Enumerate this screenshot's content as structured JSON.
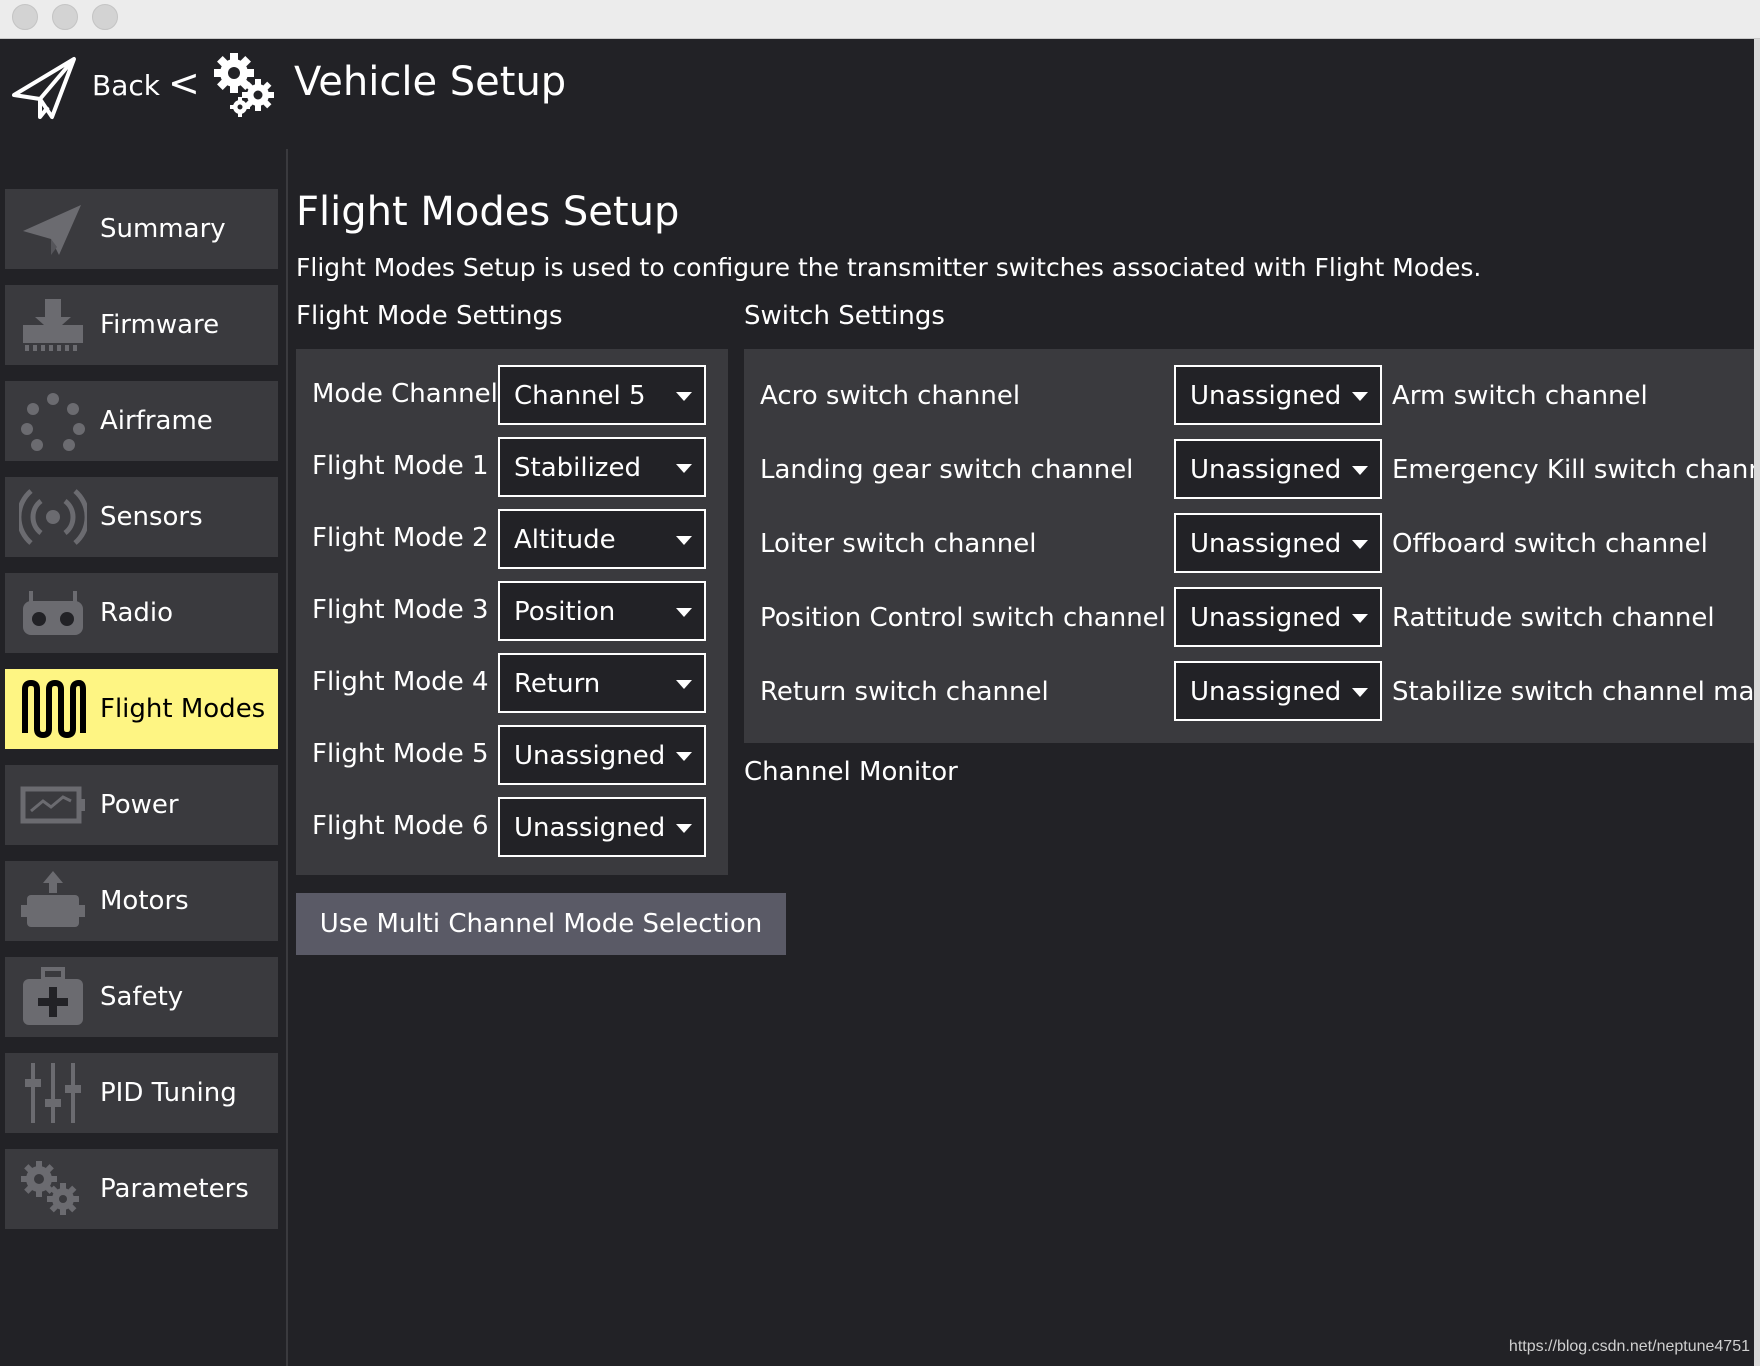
{
  "header": {
    "back_label": "Back",
    "separator": "<",
    "title": "Vehicle Setup"
  },
  "sidebar": {
    "items": [
      {
        "label": "Summary",
        "icon": "plane-icon",
        "active": false
      },
      {
        "label": "Firmware",
        "icon": "download-icon",
        "active": false
      },
      {
        "label": "Airframe",
        "icon": "airframe-icon",
        "active": false
      },
      {
        "label": "Sensors",
        "icon": "sensors-icon",
        "active": false
      },
      {
        "label": "Radio",
        "icon": "radio-icon",
        "active": false
      },
      {
        "label": "Flight Modes",
        "icon": "flight-modes-icon",
        "active": true
      },
      {
        "label": "Power",
        "icon": "power-icon",
        "active": false
      },
      {
        "label": "Motors",
        "icon": "motors-icon",
        "active": false
      },
      {
        "label": "Safety",
        "icon": "safety-icon",
        "active": false
      },
      {
        "label": "PID Tuning",
        "icon": "pid-tuning-icon",
        "active": false
      },
      {
        "label": "Parameters",
        "icon": "parameters-icon",
        "active": false
      }
    ]
  },
  "main": {
    "title": "Flight Modes Setup",
    "description": "Flight Modes Setup is used to configure the transmitter switches associated with Flight Modes.",
    "flight_mode_settings_label": "Flight Mode Settings",
    "switch_settings_label": "Switch Settings",
    "channel_monitor_label": "Channel Monitor",
    "flight_modes": [
      {
        "label": "Mode Channel",
        "value": "Channel 5"
      },
      {
        "label": "Flight Mode 1",
        "value": "Stabilized"
      },
      {
        "label": "Flight Mode 2",
        "value": "Altitude"
      },
      {
        "label": "Flight Mode 3",
        "value": "Position"
      },
      {
        "label": "Flight Mode 4",
        "value": "Return"
      },
      {
        "label": "Flight Mode 5",
        "value": "Unassigned"
      },
      {
        "label": "Flight Mode 6",
        "value": "Unassigned"
      }
    ],
    "switches": [
      {
        "label": "Acro switch channel",
        "value": "Unassigned",
        "right_label": "Arm switch channel"
      },
      {
        "label": "Landing gear switch channel",
        "value": "Unassigned",
        "right_label": "Emergency Kill switch chann"
      },
      {
        "label": "Loiter switch channel",
        "value": "Unassigned",
        "right_label": "Offboard switch channel"
      },
      {
        "label": "Position Control switch channel",
        "value": "Unassigned",
        "right_label": "Rattitude switch channel"
      },
      {
        "label": "Return switch channel",
        "value": "Unassigned",
        "right_label": "Stabilize switch channel ma"
      }
    ],
    "multi_channel_button": "Use Multi Channel Mode Selection"
  },
  "watermark": "https://blog.csdn.net/neptune4751",
  "colors": {
    "background": "#222226",
    "panel": "#3a3a3e",
    "active": "#fef583",
    "button": "#5a5a66"
  }
}
